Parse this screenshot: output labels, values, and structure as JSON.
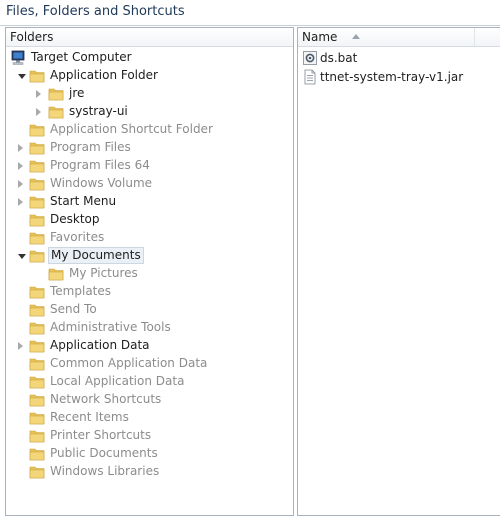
{
  "title": "Files, Folders and Shortcuts",
  "folders_header": "Folders",
  "name_header": "Name",
  "colors": {
    "active_text": "#1e1e1e",
    "dim_text": "#8c8c8c",
    "folder": "#e8c256",
    "title_text": "#1e3958"
  },
  "tree": [
    {
      "label": "Target Computer",
      "icon": "computer-icon",
      "depth": 0,
      "expander": "none",
      "state": "active"
    },
    {
      "label": "Application Folder",
      "icon": "folder-icon",
      "depth": 1,
      "expander": "expanded",
      "state": "active"
    },
    {
      "label": "jre",
      "icon": "folder-icon",
      "depth": 2,
      "expander": "collapsed",
      "state": "active"
    },
    {
      "label": "systray-ui",
      "icon": "folder-icon",
      "depth": 2,
      "expander": "collapsed",
      "state": "active"
    },
    {
      "label": "Application Shortcut Folder",
      "icon": "folder-icon",
      "depth": 1,
      "expander": "none",
      "state": "dim"
    },
    {
      "label": "Program Files",
      "icon": "folder-icon",
      "depth": 1,
      "expander": "collapsed",
      "state": "dim"
    },
    {
      "label": "Program Files 64",
      "icon": "folder-icon",
      "depth": 1,
      "expander": "collapsed",
      "state": "dim"
    },
    {
      "label": "Windows Volume",
      "icon": "folder-icon",
      "depth": 1,
      "expander": "collapsed",
      "state": "dim"
    },
    {
      "label": "Start Menu",
      "icon": "folder-icon",
      "depth": 1,
      "expander": "collapsed",
      "state": "active"
    },
    {
      "label": "Desktop",
      "icon": "folder-icon",
      "depth": 1,
      "expander": "none",
      "state": "active"
    },
    {
      "label": "Favorites",
      "icon": "folder-icon",
      "depth": 1,
      "expander": "none",
      "state": "dim"
    },
    {
      "label": "My Documents",
      "icon": "folder-icon",
      "depth": 1,
      "expander": "expanded",
      "state": "selected"
    },
    {
      "label": "My Pictures",
      "icon": "folder-icon",
      "depth": 2,
      "expander": "none",
      "state": "dim"
    },
    {
      "label": "Templates",
      "icon": "folder-icon",
      "depth": 1,
      "expander": "none",
      "state": "dim"
    },
    {
      "label": "Send To",
      "icon": "folder-icon",
      "depth": 1,
      "expander": "none",
      "state": "dim"
    },
    {
      "label": "Administrative Tools",
      "icon": "folder-icon",
      "depth": 1,
      "expander": "none",
      "state": "dim"
    },
    {
      "label": "Application Data",
      "icon": "folder-icon",
      "depth": 1,
      "expander": "collapsed",
      "state": "active"
    },
    {
      "label": "Common Application Data",
      "icon": "folder-icon",
      "depth": 1,
      "expander": "none",
      "state": "dim"
    },
    {
      "label": "Local Application Data",
      "icon": "folder-icon",
      "depth": 1,
      "expander": "none",
      "state": "dim"
    },
    {
      "label": "Network Shortcuts",
      "icon": "folder-icon",
      "depth": 1,
      "expander": "none",
      "state": "dim"
    },
    {
      "label": "Recent Items",
      "icon": "folder-icon",
      "depth": 1,
      "expander": "none",
      "state": "dim"
    },
    {
      "label": "Printer Shortcuts",
      "icon": "folder-icon",
      "depth": 1,
      "expander": "none",
      "state": "dim"
    },
    {
      "label": "Public Documents",
      "icon": "folder-icon",
      "depth": 1,
      "expander": "none",
      "state": "dim"
    },
    {
      "label": "Windows Libraries",
      "icon": "folder-icon",
      "depth": 1,
      "expander": "none",
      "state": "dim"
    }
  ],
  "files": [
    {
      "name": "ds.bat",
      "icon": "batch-file-icon"
    },
    {
      "name": "ttnet-system-tray-v1.jar",
      "icon": "jar-file-icon"
    }
  ]
}
